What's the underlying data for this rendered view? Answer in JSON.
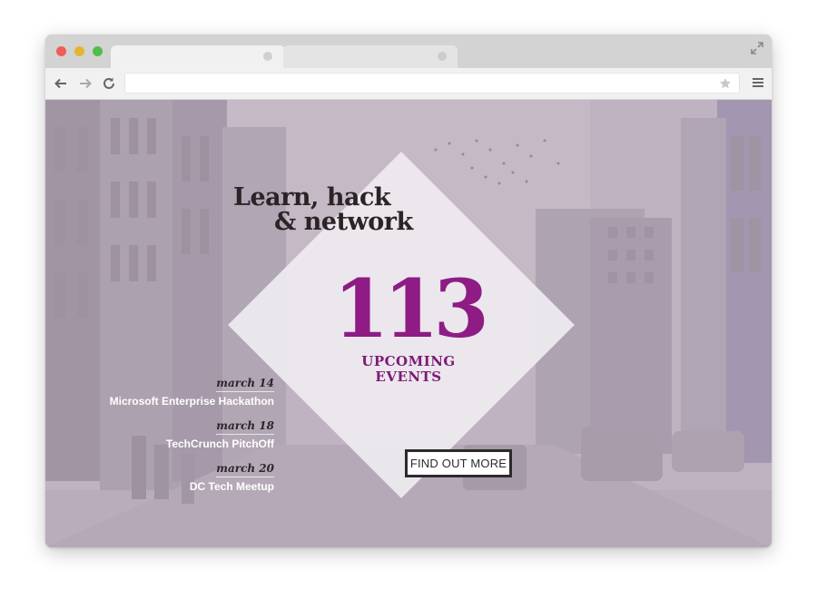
{
  "browser": {
    "address_value": "",
    "icons": {
      "back": "back-arrow-icon",
      "forward": "forward-arrow-icon",
      "reload": "reload-icon",
      "bookmark": "star-icon",
      "menu": "hamburger-menu-icon",
      "expand": "expand-icon"
    },
    "traffic_lights": [
      "#ee5d56",
      "#e5b531",
      "#4fbd4a"
    ]
  },
  "hero": {
    "headline_line1": "Learn, hack",
    "headline_line2": "& network",
    "count": "113",
    "count_label_line1": "UPCOMING",
    "count_label_line2": "EVENTS",
    "cta_label": "FIND OUT MORE"
  },
  "events": [
    {
      "date": "march 14",
      "name": "Microsoft Enterprise Hackathon"
    },
    {
      "date": "march 18",
      "name": "TechCrunch PitchOff"
    },
    {
      "date": "march 20",
      "name": "DC Tech Meetup"
    }
  ],
  "colors": {
    "accent": "#8e1c84",
    "overlay": "#b9adbb",
    "text_dark": "#2a2426"
  }
}
